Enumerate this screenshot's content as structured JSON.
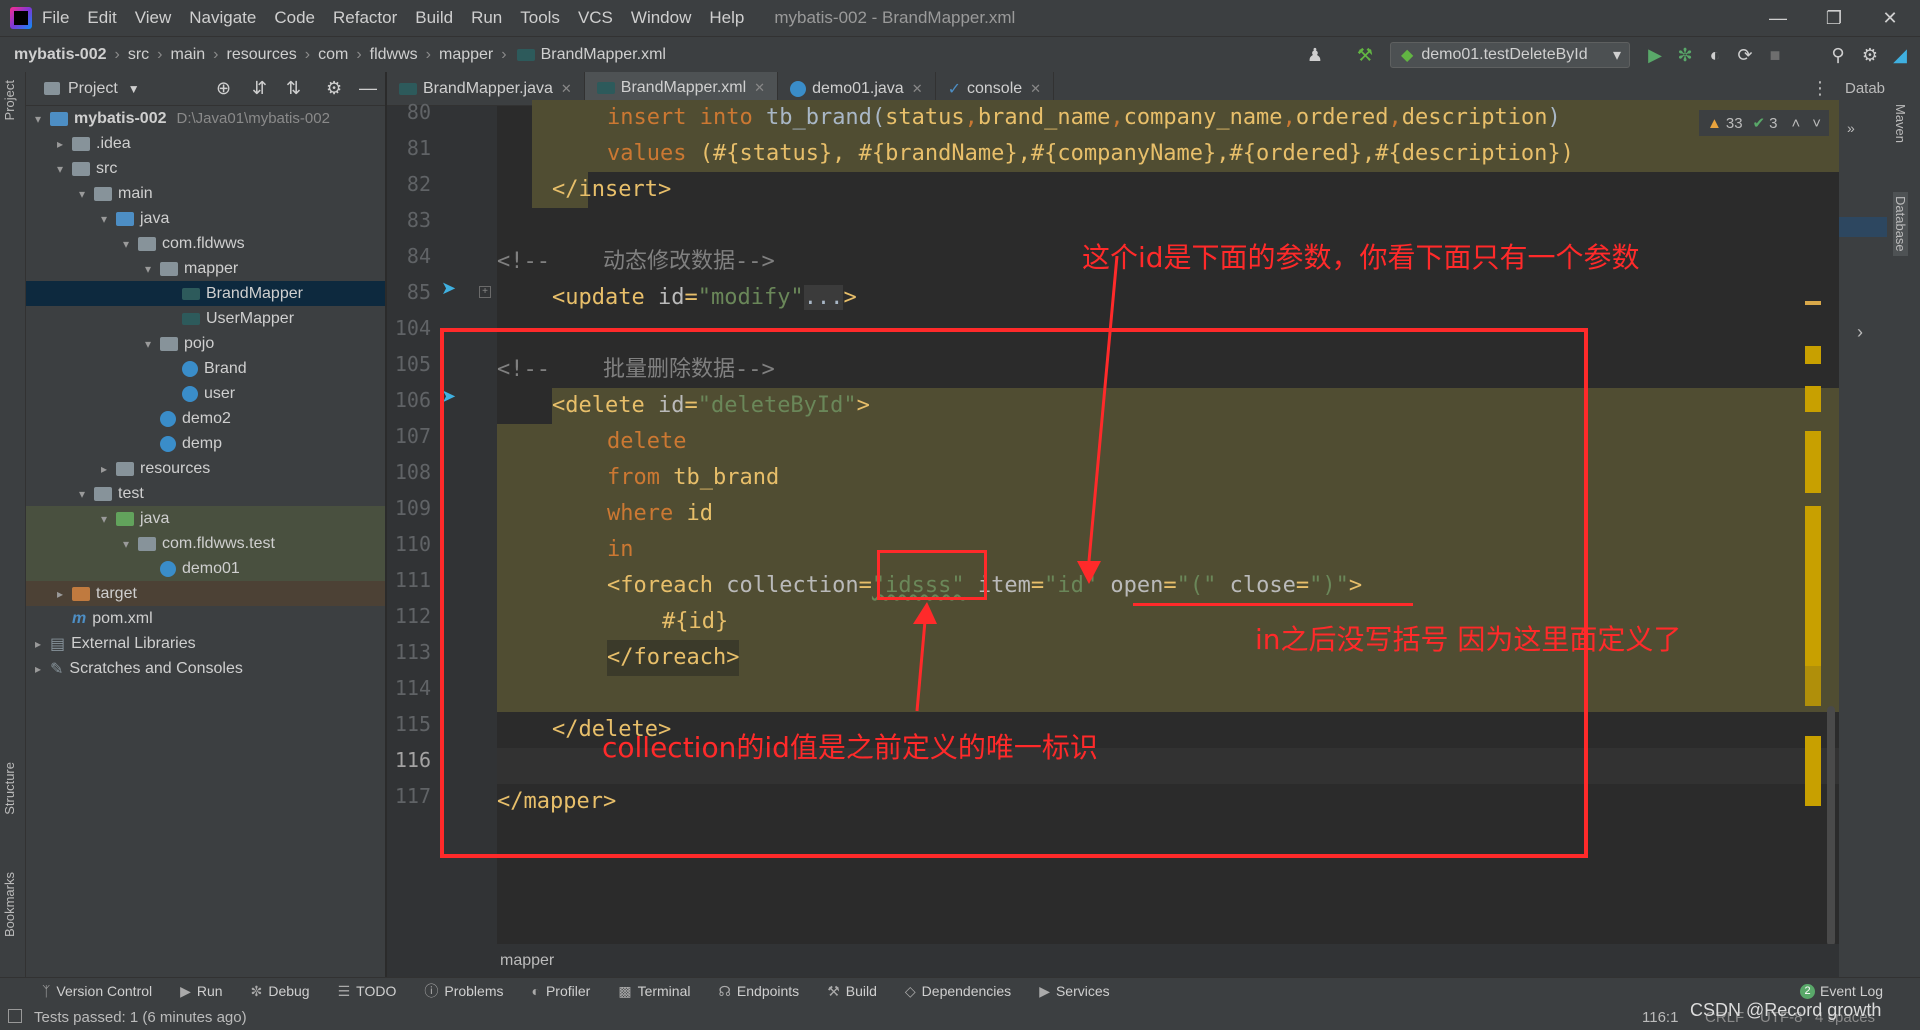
{
  "menu": [
    "File",
    "Edit",
    "View",
    "Navigate",
    "Code",
    "Refactor",
    "Build",
    "Run",
    "Tools",
    "VCS",
    "Window",
    "Help"
  ],
  "window_title": "mybatis-002 - BrandMapper.xml",
  "breadcrumb": [
    "mybatis-002",
    "src",
    "main",
    "resources",
    "com",
    "fldwws",
    "mapper",
    "BrandMapper.xml"
  ],
  "run_config": "demo01.testDeleteById",
  "project_panel": {
    "title": "Project",
    "root": "mybatis-002",
    "root_path": "D:\\Java01\\mybatis-002",
    "items": [
      ".idea",
      "src",
      "main",
      "java",
      "com.fldwws",
      "mapper",
      "BrandMapper",
      "UserMapper",
      "pojo",
      "Brand",
      "user",
      "demo2",
      "demp",
      "resources",
      "test",
      "java",
      "com.fldwws.test",
      "demo01",
      "target",
      "pom.xml",
      "External Libraries",
      "Scratches and Consoles"
    ]
  },
  "left_strip": [
    "Project",
    "Structure",
    "Bookmarks"
  ],
  "right_strip": [
    "Datab",
    "Maven",
    "Database"
  ],
  "tabs": [
    "BrandMapper.java",
    "BrandMapper.xml",
    "demo01.java",
    "console"
  ],
  "inspections": {
    "warnings": "33",
    "typos": "3"
  },
  "line_numbers": [
    "80",
    "81",
    "82",
    "83",
    "84",
    "85",
    "104",
    "105",
    "106",
    "107",
    "108",
    "109",
    "110",
    "111",
    "112",
    "113",
    "114",
    "115",
    "116",
    "117"
  ],
  "code": {
    "l80": [
      "insert",
      " into",
      " tb_brand(",
      "status",
      ",",
      "brand_name",
      ",",
      "company_name",
      ",",
      "ordered",
      ",",
      "description",
      ")"
    ],
    "l81": [
      "values",
      " (#{status}, #{brandName},#{companyName},#{ordered},#{description})"
    ],
    "l82": "</insert>",
    "l84": [
      "<!--",
      "    动态修改数据-->"
    ],
    "l85": [
      "<update ",
      "id",
      "=",
      "\"modify\"",
      "...",
      ">"
    ],
    "l105": [
      "<!--",
      "    批量删除数据-->"
    ],
    "l106": [
      "<delete ",
      "id",
      "=",
      "\"deleteById\"",
      ">"
    ],
    "l107": "delete",
    "l108": [
      "from",
      " tb_brand"
    ],
    "l109": [
      "where",
      " id"
    ],
    "l110": "in",
    "l111": [
      "<foreach ",
      "collection",
      "=",
      "\"idsss\"",
      " item",
      "=",
      "\"id\"",
      " open",
      "=",
      "\"(\"",
      " close",
      "=",
      "\")\"",
      ">"
    ],
    "l112": "#{id}",
    "l113": "</foreach>",
    "l115": "</delete>",
    "l117": "</mapper>"
  },
  "annotations": {
    "top": "这个id是下面的参数，你看下面只有一个参数",
    "right": "in之后没写括号 因为这里面定义了",
    "bottom": "collection的id值是之前定义的唯一标识"
  },
  "footer_breadcrumb": "mapper",
  "tool_windows": [
    "Version Control",
    "Run",
    "Debug",
    "TODO",
    "Problems",
    "Profiler",
    "Terminal",
    "Endpoints",
    "Build",
    "Dependencies",
    "Services"
  ],
  "event_log": "Event Log",
  "event_count": "2",
  "status": {
    "message": "Tests passed: 1 (6 minutes ago)",
    "position": "116:1",
    "line_sep": "CRLF",
    "encoding": "UTF-8",
    "indent": "4 spaces"
  },
  "watermark": "CSDN @Record growth"
}
